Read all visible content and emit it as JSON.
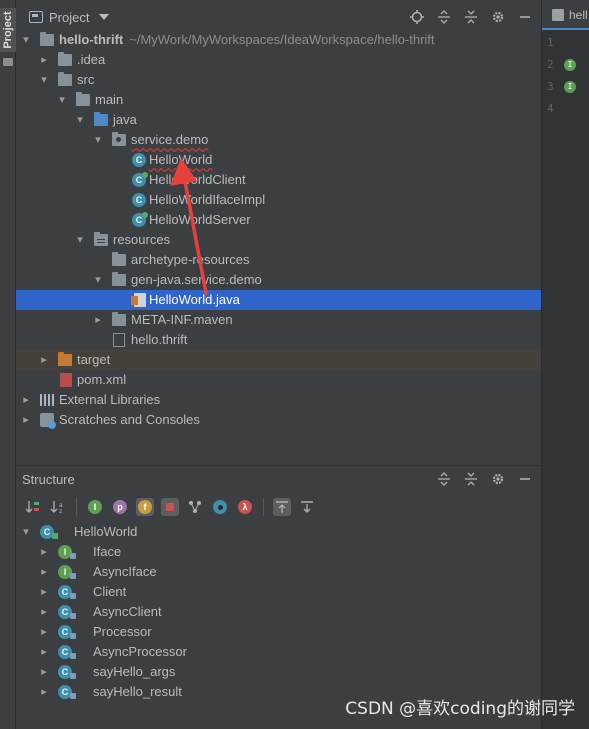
{
  "side_strip": {
    "label": "Project"
  },
  "project_panel": {
    "title": "Project",
    "tree": [
      {
        "label": "hello-thrift",
        "path": "~/MyWork/MyWorkspaces/IdeaWorkspace/hello-thrift"
      },
      {
        "label": ".idea"
      },
      {
        "label": "src"
      },
      {
        "label": "main"
      },
      {
        "label": "java"
      },
      {
        "label": "service.demo"
      },
      {
        "label": "HelloWorld"
      },
      {
        "label": "HelloWorldClient"
      },
      {
        "label": "HelloWorldIfaceImpl"
      },
      {
        "label": "HelloWorldServer"
      },
      {
        "label": "resources"
      },
      {
        "label": "archetype-resources"
      },
      {
        "label": "gen-java.service.demo"
      },
      {
        "label": "HelloWorld.java"
      },
      {
        "label": "META-INF.maven"
      },
      {
        "label": "hello.thrift"
      },
      {
        "label": "target"
      },
      {
        "label": "pom.xml"
      },
      {
        "label": "External Libraries"
      },
      {
        "label": "Scratches and Consoles"
      }
    ]
  },
  "structure_panel": {
    "title": "Structure",
    "toolbar": [
      "sort-visibility",
      "sort-alpha",
      "show-inherited",
      "properties",
      "fields",
      "non-public",
      "anonymous",
      "lambdas",
      "autoscroll-to-source",
      "autoscroll-from-source"
    ],
    "root": "HelloWorld",
    "items": [
      "Iface",
      "AsyncIface",
      "Client",
      "AsyncClient",
      "Processor",
      "AsyncProcessor",
      "sayHello_args",
      "sayHello_result"
    ]
  },
  "editor": {
    "tab_label": "hell",
    "line_numbers": [
      "1",
      "2",
      "3",
      "4"
    ]
  },
  "watermark": "CSDN @喜欢coding的谢同学",
  "colors": {
    "selection": "#2f65ca",
    "annotation_arrow": "#e8413b",
    "panel_bg": "#3c3f41"
  }
}
